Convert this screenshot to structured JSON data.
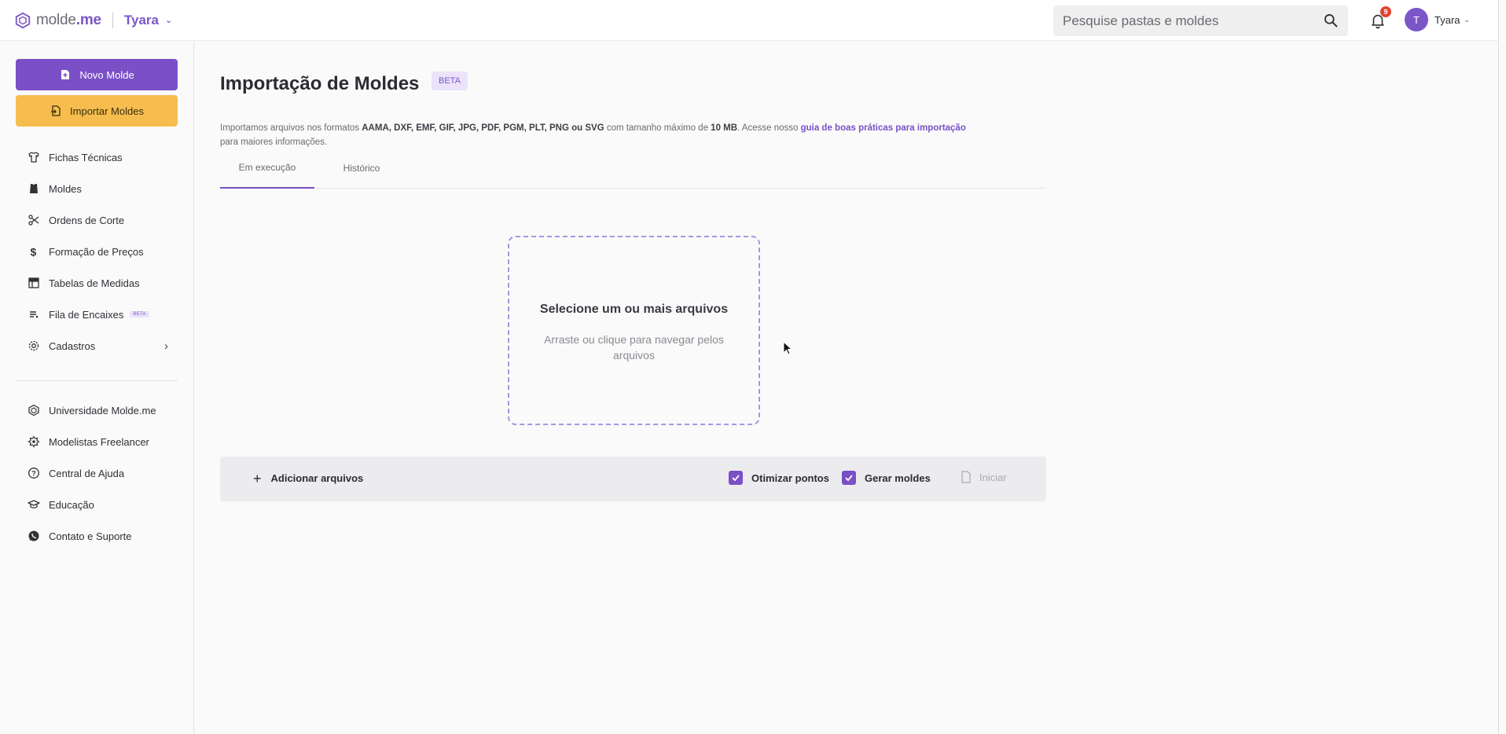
{
  "brand": {
    "name_light": "molde",
    "name_bold": ".me",
    "workspace": "Tyara"
  },
  "search": {
    "placeholder": "Pesquise pastas e moldes"
  },
  "notifications": {
    "count": "9"
  },
  "user": {
    "initial": "T",
    "name": "Tyara"
  },
  "sidebar": {
    "new_button": "Novo Molde",
    "import_button": "Importar Moldes",
    "items": [
      {
        "label": "Fichas Técnicas",
        "icon": "shirt-icon"
      },
      {
        "label": "Moldes",
        "icon": "pattern-icon"
      },
      {
        "label": "Ordens de Corte",
        "icon": "scissors-icon"
      },
      {
        "label": "Formação de Preços",
        "icon": "dollar-icon"
      },
      {
        "label": "Tabelas de Medidas",
        "icon": "table-icon"
      },
      {
        "label": "Fila de Encaixes",
        "icon": "queue-icon",
        "badge": "BETA"
      },
      {
        "label": "Cadastros",
        "icon": "gear-icon"
      }
    ],
    "secondary_items": [
      {
        "label": "Universidade Molde.me",
        "icon": "logo-icon"
      },
      {
        "label": "Modelistas Freelancer",
        "icon": "freelancer-icon"
      },
      {
        "label": "Central de Ajuda",
        "icon": "help-icon"
      },
      {
        "label": "Educação",
        "icon": "education-icon"
      },
      {
        "label": "Contato e Suporte",
        "icon": "whatsapp-icon"
      }
    ]
  },
  "main": {
    "title": "Importação de Moldes",
    "badge": "BETA",
    "description": {
      "part1": "Importamos arquivos nos formatos ",
      "formats": "AAMA, DXF, EMF, GIF, JPG, PDF, PGM, PLT, PNG ou SVG",
      "part2": " com tamanho máximo de ",
      "max_size": "10 MB",
      "part3": ". Acesse nosso ",
      "link": "guia de boas práticas para importação",
      "part4": " para maiores informações."
    },
    "tabs": [
      {
        "label": "Em execução",
        "active": true
      },
      {
        "label": "Histórico",
        "active": false
      }
    ],
    "dropzone": {
      "title": "Selecione um ou mais arquivos",
      "subtitle": "Arraste ou clique para navegar pelos arquivos"
    },
    "actions": {
      "add_files": "Adicionar arquivos",
      "optimize_points": "Otimizar pontos",
      "optimize_checked": true,
      "generate_patterns": "Gerar moldes",
      "generate_checked": true,
      "start": "Iniciar"
    }
  },
  "colors": {
    "accent": "#7b4fc6",
    "import_button": "#f6bd4e",
    "badge_bg": "#ebe3fa",
    "notification_badge": "#e2432f"
  }
}
